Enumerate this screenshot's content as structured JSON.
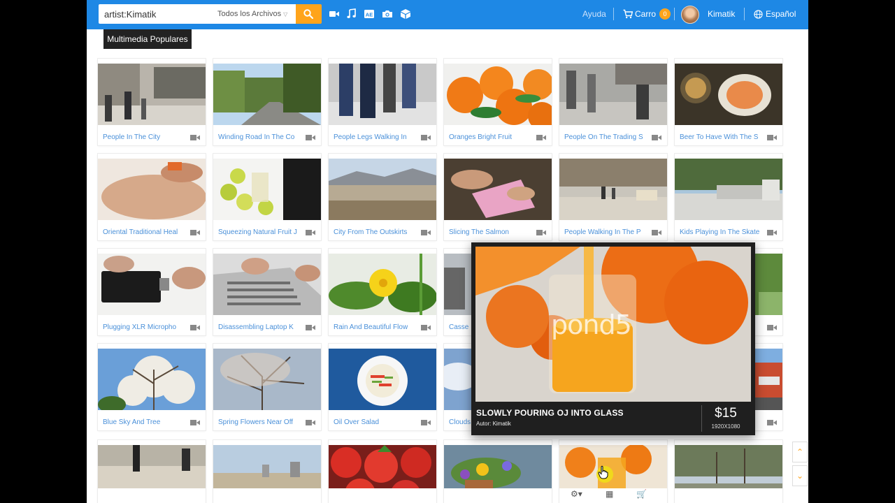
{
  "search": {
    "value": "artist:Kimatik",
    "scope": "Todos los Archivos"
  },
  "header": {
    "help": "Ayuda",
    "cart_label": "Carro",
    "cart_count": "0",
    "username": "Kimatik",
    "language": "Español"
  },
  "tooltip": "Multimedia Populares",
  "grid": {
    "items": [
      "People In The City",
      "Winding Road In The Co",
      "People Legs Walking In",
      "Oranges Bright Fruit",
      "People On The Trading S",
      "Beer To Have With The S",
      "Oriental Traditional Heal",
      "Squeezing Natural Fruit J",
      "City From The Outskirts",
      "Slicing The Salmon",
      "People Walking In The P",
      "Kids Playing In The Skate",
      "Plugging XLR Micropho",
      "Disassembling Laptop K",
      "Rain And Beautiful Flow",
      "Casse",
      "",
      "",
      "Blue Sky And Tree",
      "Spring Flowers Near Off",
      "Oil Over Salad",
      "Clouds",
      "",
      ""
    ]
  },
  "preview": {
    "title": "SLOWLY POURING OJ INTO GLASS",
    "author": "Autor: Kimatik",
    "price": "$15",
    "resolution": "1920X1080",
    "watermark": "pond5"
  },
  "colors": {
    "topbar": "#1e88e5",
    "accent": "#ffa41b",
    "caption": "#4a90d9"
  }
}
